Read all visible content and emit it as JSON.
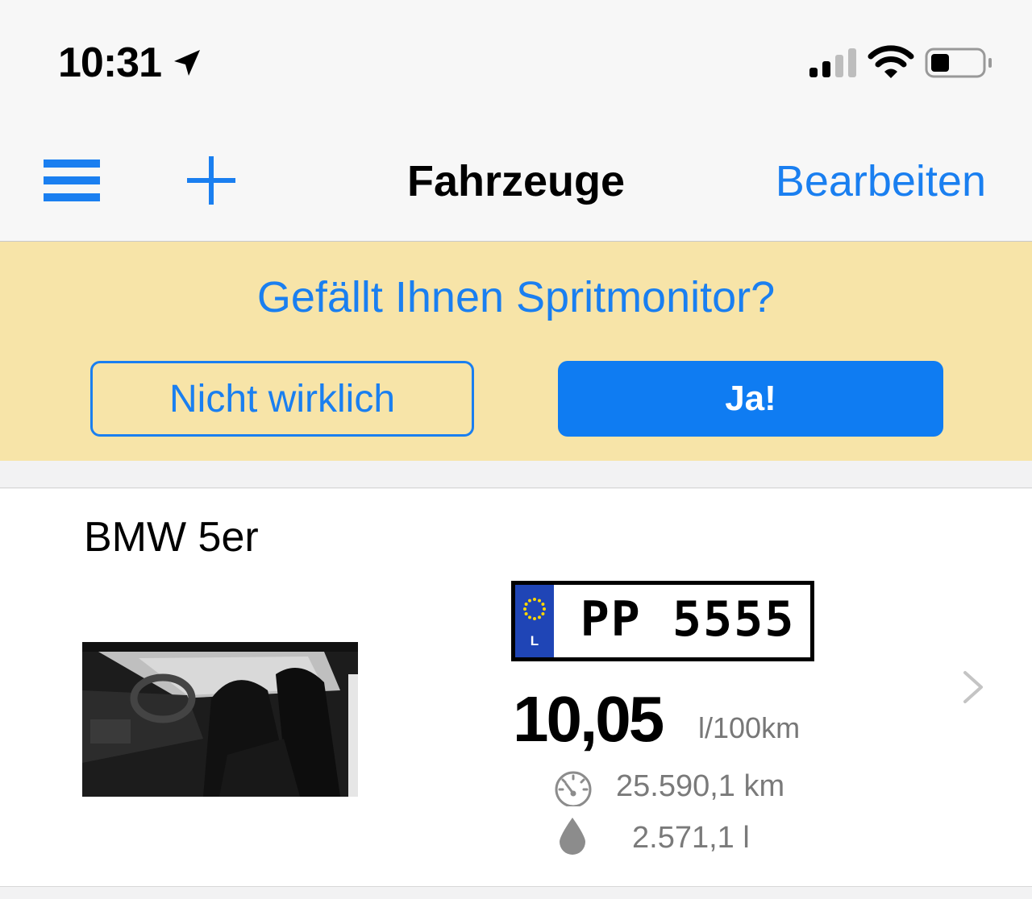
{
  "status_bar": {
    "time": "10:31",
    "icons": [
      "location-arrow-icon",
      "cellular-signal-icon",
      "wifi-icon",
      "battery-icon"
    ]
  },
  "nav": {
    "title": "Fahrzeuge",
    "edit_label": "Bearbeiten",
    "left_icons": [
      "hamburger-menu-icon",
      "plus-icon"
    ]
  },
  "rating_banner": {
    "question": "Gefällt Ihnen Spritmonitor?",
    "decline_label": "Nicht wirklich",
    "accept_label": "Ja!"
  },
  "vehicles": [
    {
      "name": "BMW 5er",
      "plate": {
        "country": "L",
        "number": "PP 5555"
      },
      "consumption": "10,05",
      "consumption_unit": "l/100km",
      "odometer": "25.590,1 km",
      "fuel_total": "2.571,1 l"
    }
  ],
  "colors": {
    "accent": "#1a7ff0",
    "banner_bg": "#f7e4a8",
    "plate_eu_blue": "#1f45b6",
    "secondary_text": "#7a7a7a"
  }
}
